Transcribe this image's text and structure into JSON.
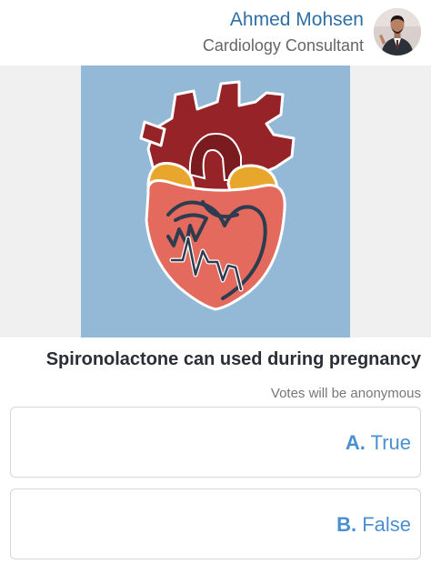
{
  "author": {
    "name": "Ahmed Mohsen",
    "role": "Cardiology Consultant"
  },
  "question": "Spironolactone can used during pregnancy",
  "anonymous_note": "Votes will be anonymous",
  "options": [
    {
      "letter": "A.",
      "text": "True"
    },
    {
      "letter": "B.",
      "text": "False"
    }
  ],
  "colors": {
    "accent": "#4a8fd0",
    "author_name": "#2f6fa8",
    "image_background": "#93b9d6"
  },
  "icons": {
    "avatar": "person-photo",
    "illustration": "heart-illustration"
  }
}
